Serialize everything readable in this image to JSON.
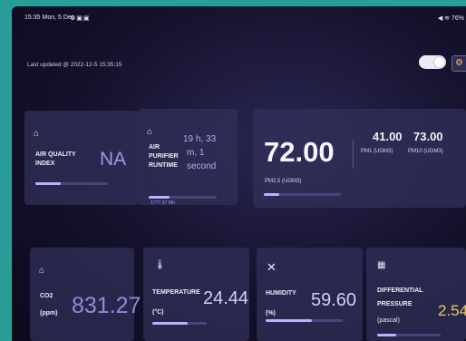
{
  "status_bar": {
    "time": "15:35",
    "date": "Mon, 5 Dec",
    "right": "76%"
  },
  "header": {
    "last_updated": "Last updated @ 2022-12-5 15:35:15"
  },
  "cards": {
    "aqi": {
      "label_1": "AIR QUALITY",
      "label_2": "INDEX",
      "value": "NA",
      "bar_fraction": 0.35
    },
    "runtime": {
      "label_1": "AIR",
      "label_2": "PURIFIER",
      "label_3": "RUNTIME",
      "value_1": "19 h, 33",
      "value_2": "m, 1",
      "value_3": "second",
      "energy": "1777.37 Wh",
      "bar_fraction": 0.3
    },
    "pm": {
      "pm25_value": "72.00",
      "pm25_label": "PM2.5 (UGM3)",
      "pm1_value": "41.00",
      "pm1_label": "PM1 (UGM3)",
      "pm10_value": "73.00",
      "pm10_label": "PM10 (UGM3)",
      "bar_fraction": 0.2
    },
    "co2": {
      "label_1": "CO2",
      "label_2": "(ppm)",
      "value": "831.27"
    },
    "temperature": {
      "label_1": "TEMPERATURE",
      "label_2": "(°C)",
      "value": "24.44",
      "bar_fraction": 0.65
    },
    "humidity": {
      "label_1": "HUMIDITY",
      "label_2": "(%)",
      "value": "59.60",
      "bar_fraction": 0.6
    },
    "pressure": {
      "label_1": "DIFFERENTIAL",
      "label_2": "PRESSURE",
      "label_3": "(pascal)",
      "value": "2.54",
      "bar_fraction": 0.3
    }
  },
  "icons": {
    "home": "home-icon",
    "thermometer": "thermometer-icon",
    "close": "close-icon",
    "gauge": "gauge-icon",
    "filter": "filter-icon"
  }
}
